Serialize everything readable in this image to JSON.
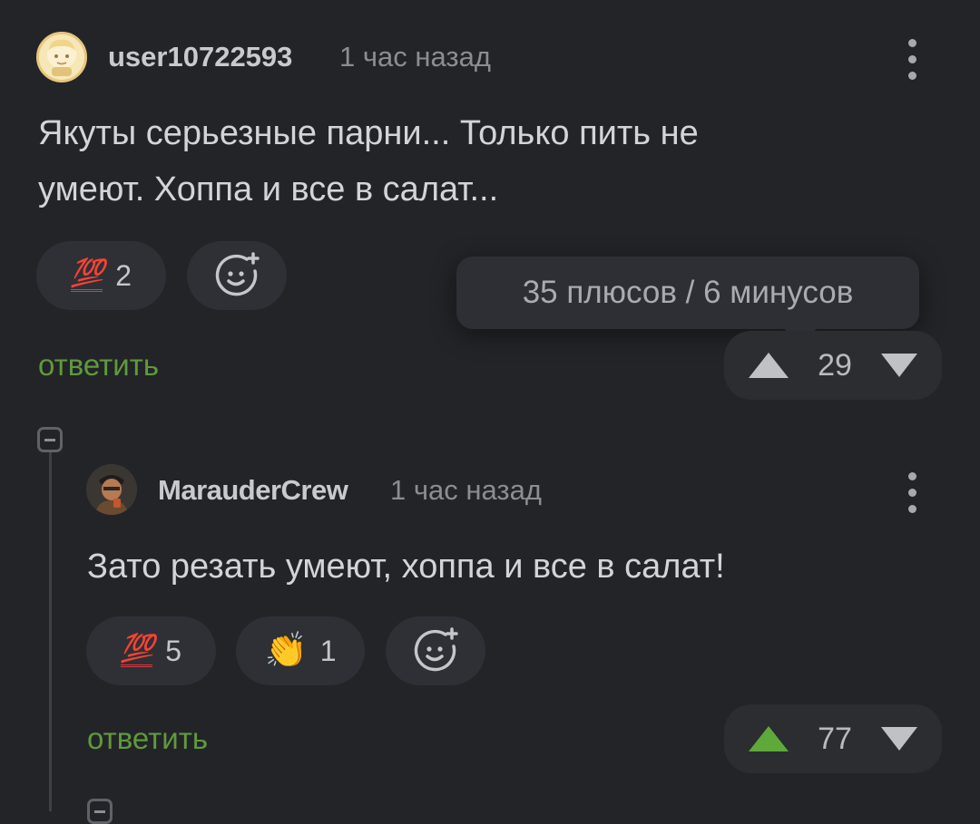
{
  "comments": [
    {
      "username": "user10722593",
      "time": "1 час назад",
      "text_lines": [
        "Якуты серьезные парни... Только пить не",
        "умеют. Хоппа и все в салат..."
      ],
      "reactions": [
        {
          "emoji": "💯",
          "count": "2"
        }
      ],
      "reply_label": "ответить",
      "rating": "29",
      "vote_state": "none"
    },
    {
      "username": "MarauderCrew",
      "time": "1 час назад",
      "text_lines": [
        "Зато резать умеют, хоппа и все в салат!"
      ],
      "reactions": [
        {
          "emoji": "💯",
          "count": "5"
        },
        {
          "emoji": "👏",
          "count": "1"
        }
      ],
      "reply_label": "ответить",
      "rating": "77",
      "vote_state": "upvoted"
    }
  ],
  "tooltip": {
    "text": "35 плюсов / 6 минусов"
  },
  "colors": {
    "background": "#232428",
    "reply_green": "#5f9a3c",
    "upvote_active": "#5fa83a",
    "vote_inactive": "#bfc1c5",
    "hundred_red": "#e0363e"
  },
  "icons": {
    "add_reaction": "smiley-plus-icon",
    "more": "vertical-dots-icon",
    "upvote": "triangle-up-icon",
    "downvote": "triangle-down-icon",
    "collapse": "minus-square-icon"
  }
}
